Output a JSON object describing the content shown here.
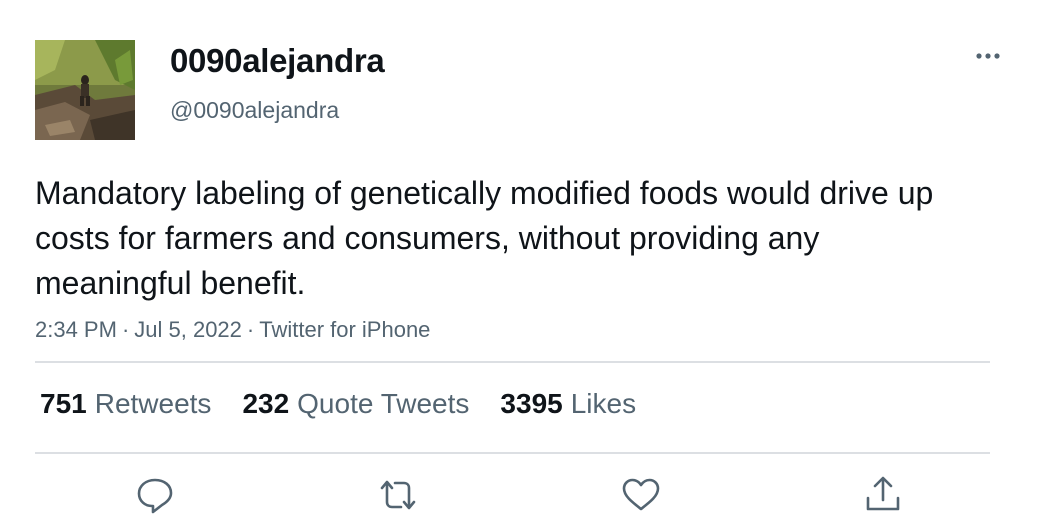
{
  "user": {
    "display_name": "0090alejandra",
    "handle": "@0090alejandra"
  },
  "tweet": {
    "text": "Mandatory labeling of genetically modified foods would drive up costs for farmers and consumers, without providing any meaningful benefit.",
    "time": "2:34 PM",
    "date": "Jul 5, 2022",
    "source": "Twitter for iPhone",
    "separator": "·"
  },
  "stats": {
    "retweets_count": "751",
    "retweets_label": "Retweets",
    "quotes_count": "232",
    "quotes_label": "Quote Tweets",
    "likes_count": "3395",
    "likes_label": "Likes"
  },
  "icons": {
    "more": "more-horizontal-icon",
    "reply": "reply-icon",
    "retweet": "retweet-icon",
    "like": "heart-icon",
    "share": "share-icon"
  },
  "colors": {
    "text": "#0f1419",
    "secondary": "#536471",
    "divider": "#dcdfe3"
  }
}
